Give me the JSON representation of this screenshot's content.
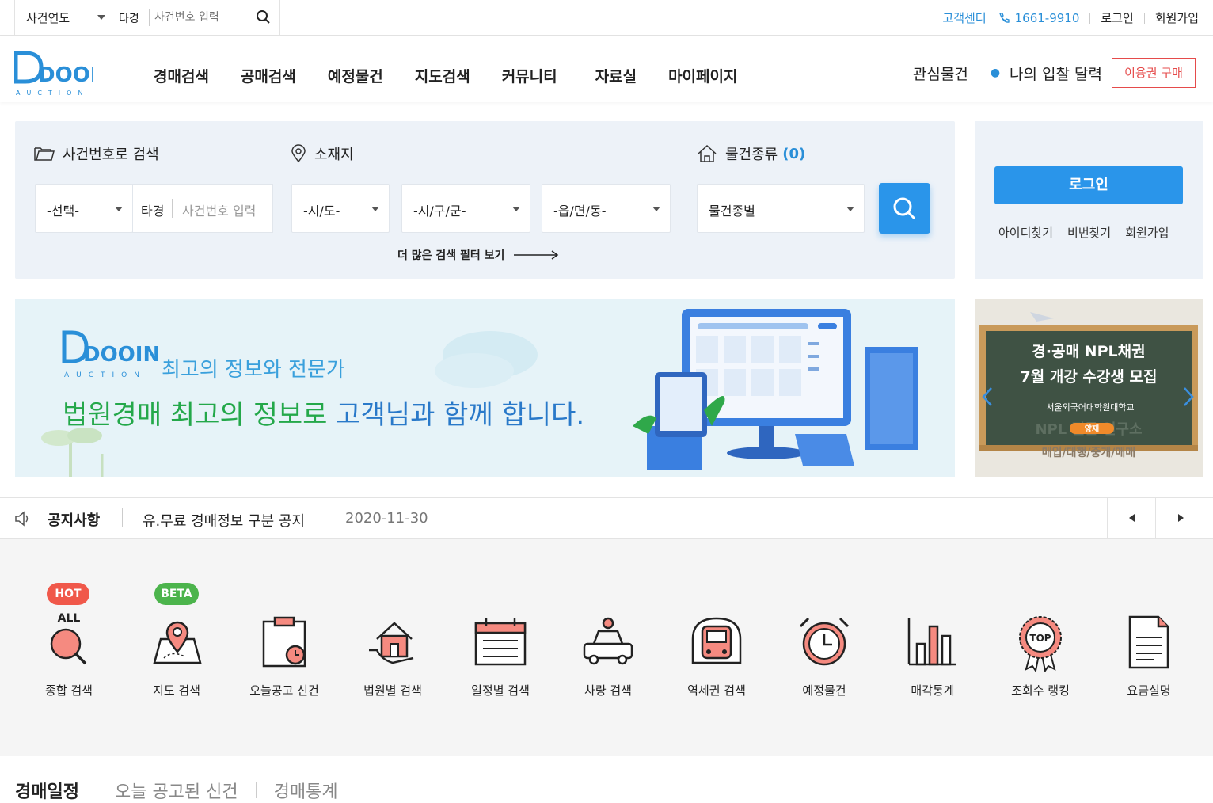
{
  "topbar": {
    "year_select": "사건연도",
    "court_prefix": "타경",
    "case_placeholder": "사건번호 입력",
    "customer_center": "고객센터",
    "phone": "1661-9910",
    "login": "로그인",
    "signup": "회원가입"
  },
  "header": {
    "logo_text": "DOOIN",
    "logo_sub": "AUCTION",
    "nav": [
      "경매검색",
      "공매검색",
      "예정물건",
      "지도검색",
      "커뮤니티",
      "자료실",
      "마이페이지"
    ],
    "watch_items": "관심물건",
    "bid_calendar": "나의 입찰 달력",
    "buy_pass": "이용권 구매"
  },
  "search": {
    "case_title": "사건번호로 검색",
    "location_title": "소재지",
    "type_title": "물건종류",
    "type_count": "(0)",
    "select_label": "-선택-",
    "court_prefix": "타경",
    "case_placeholder": "사건번호 입력",
    "sido": "-시/도-",
    "sigungu": "-시/구/군-",
    "dong": "-읍/면/동-",
    "type_select": "물건종별",
    "more_filters": "더 많은 검색 필터 보기"
  },
  "login_panel": {
    "login_button": "로그인",
    "find_id": "아이디찾기",
    "find_pw": "비번찾기",
    "signup": "회원가입"
  },
  "banner": {
    "logo_text": "DOOIN",
    "logo_sub": "AUCTION",
    "subtitle": "최고의 정보와 전문가",
    "main_1": "법원경매 최고의 정보로 ",
    "main_2": "고객님과 함께 합니다."
  },
  "side_banner": {
    "line1": "경·공매 NPL채권",
    "line2": "7월 개강 수강생 모집",
    "school": "서울외국어대학원대학교",
    "badge": "양재",
    "faint1": "NPL 전문 연구소",
    "faint2": "매입/대행/중개/매매"
  },
  "notice": {
    "label": "공지사항",
    "text": "유.무료 경매정보 구분 공지",
    "date": "2020-11-30"
  },
  "quick_menu": [
    {
      "label": "종합 검색",
      "badge": "HOT",
      "badge_color": "#f0584a",
      "icon": "all-search-icon",
      "sub": "ALL"
    },
    {
      "label": "지도 검색",
      "badge": "BETA",
      "badge_color": "#4cb44c",
      "icon": "map-pin-icon"
    },
    {
      "label": "오늘공고 신건",
      "icon": "clipboard-clock-icon"
    },
    {
      "label": "법원별 검색",
      "icon": "house-hand-icon"
    },
    {
      "label": "일정별 검색",
      "icon": "calendar-icon"
    },
    {
      "label": "차량 검색",
      "icon": "car-icon"
    },
    {
      "label": "역세권 검색",
      "icon": "train-icon"
    },
    {
      "label": "예정물건",
      "icon": "alarm-clock-icon"
    },
    {
      "label": "매각통계",
      "icon": "bar-chart-icon"
    },
    {
      "label": "조회수 랭킹",
      "icon": "top-rank-icon",
      "sub": "TOP"
    },
    {
      "label": "요금설명",
      "icon": "document-icon"
    }
  ],
  "tabs": [
    "경매일정",
    "오늘 공고된 신건",
    "경매통계"
  ],
  "colors": {
    "accent_blue": "#2a95ea",
    "red": "#e54b4b",
    "icon_red": "#f0584a",
    "green": "#24a84a"
  }
}
